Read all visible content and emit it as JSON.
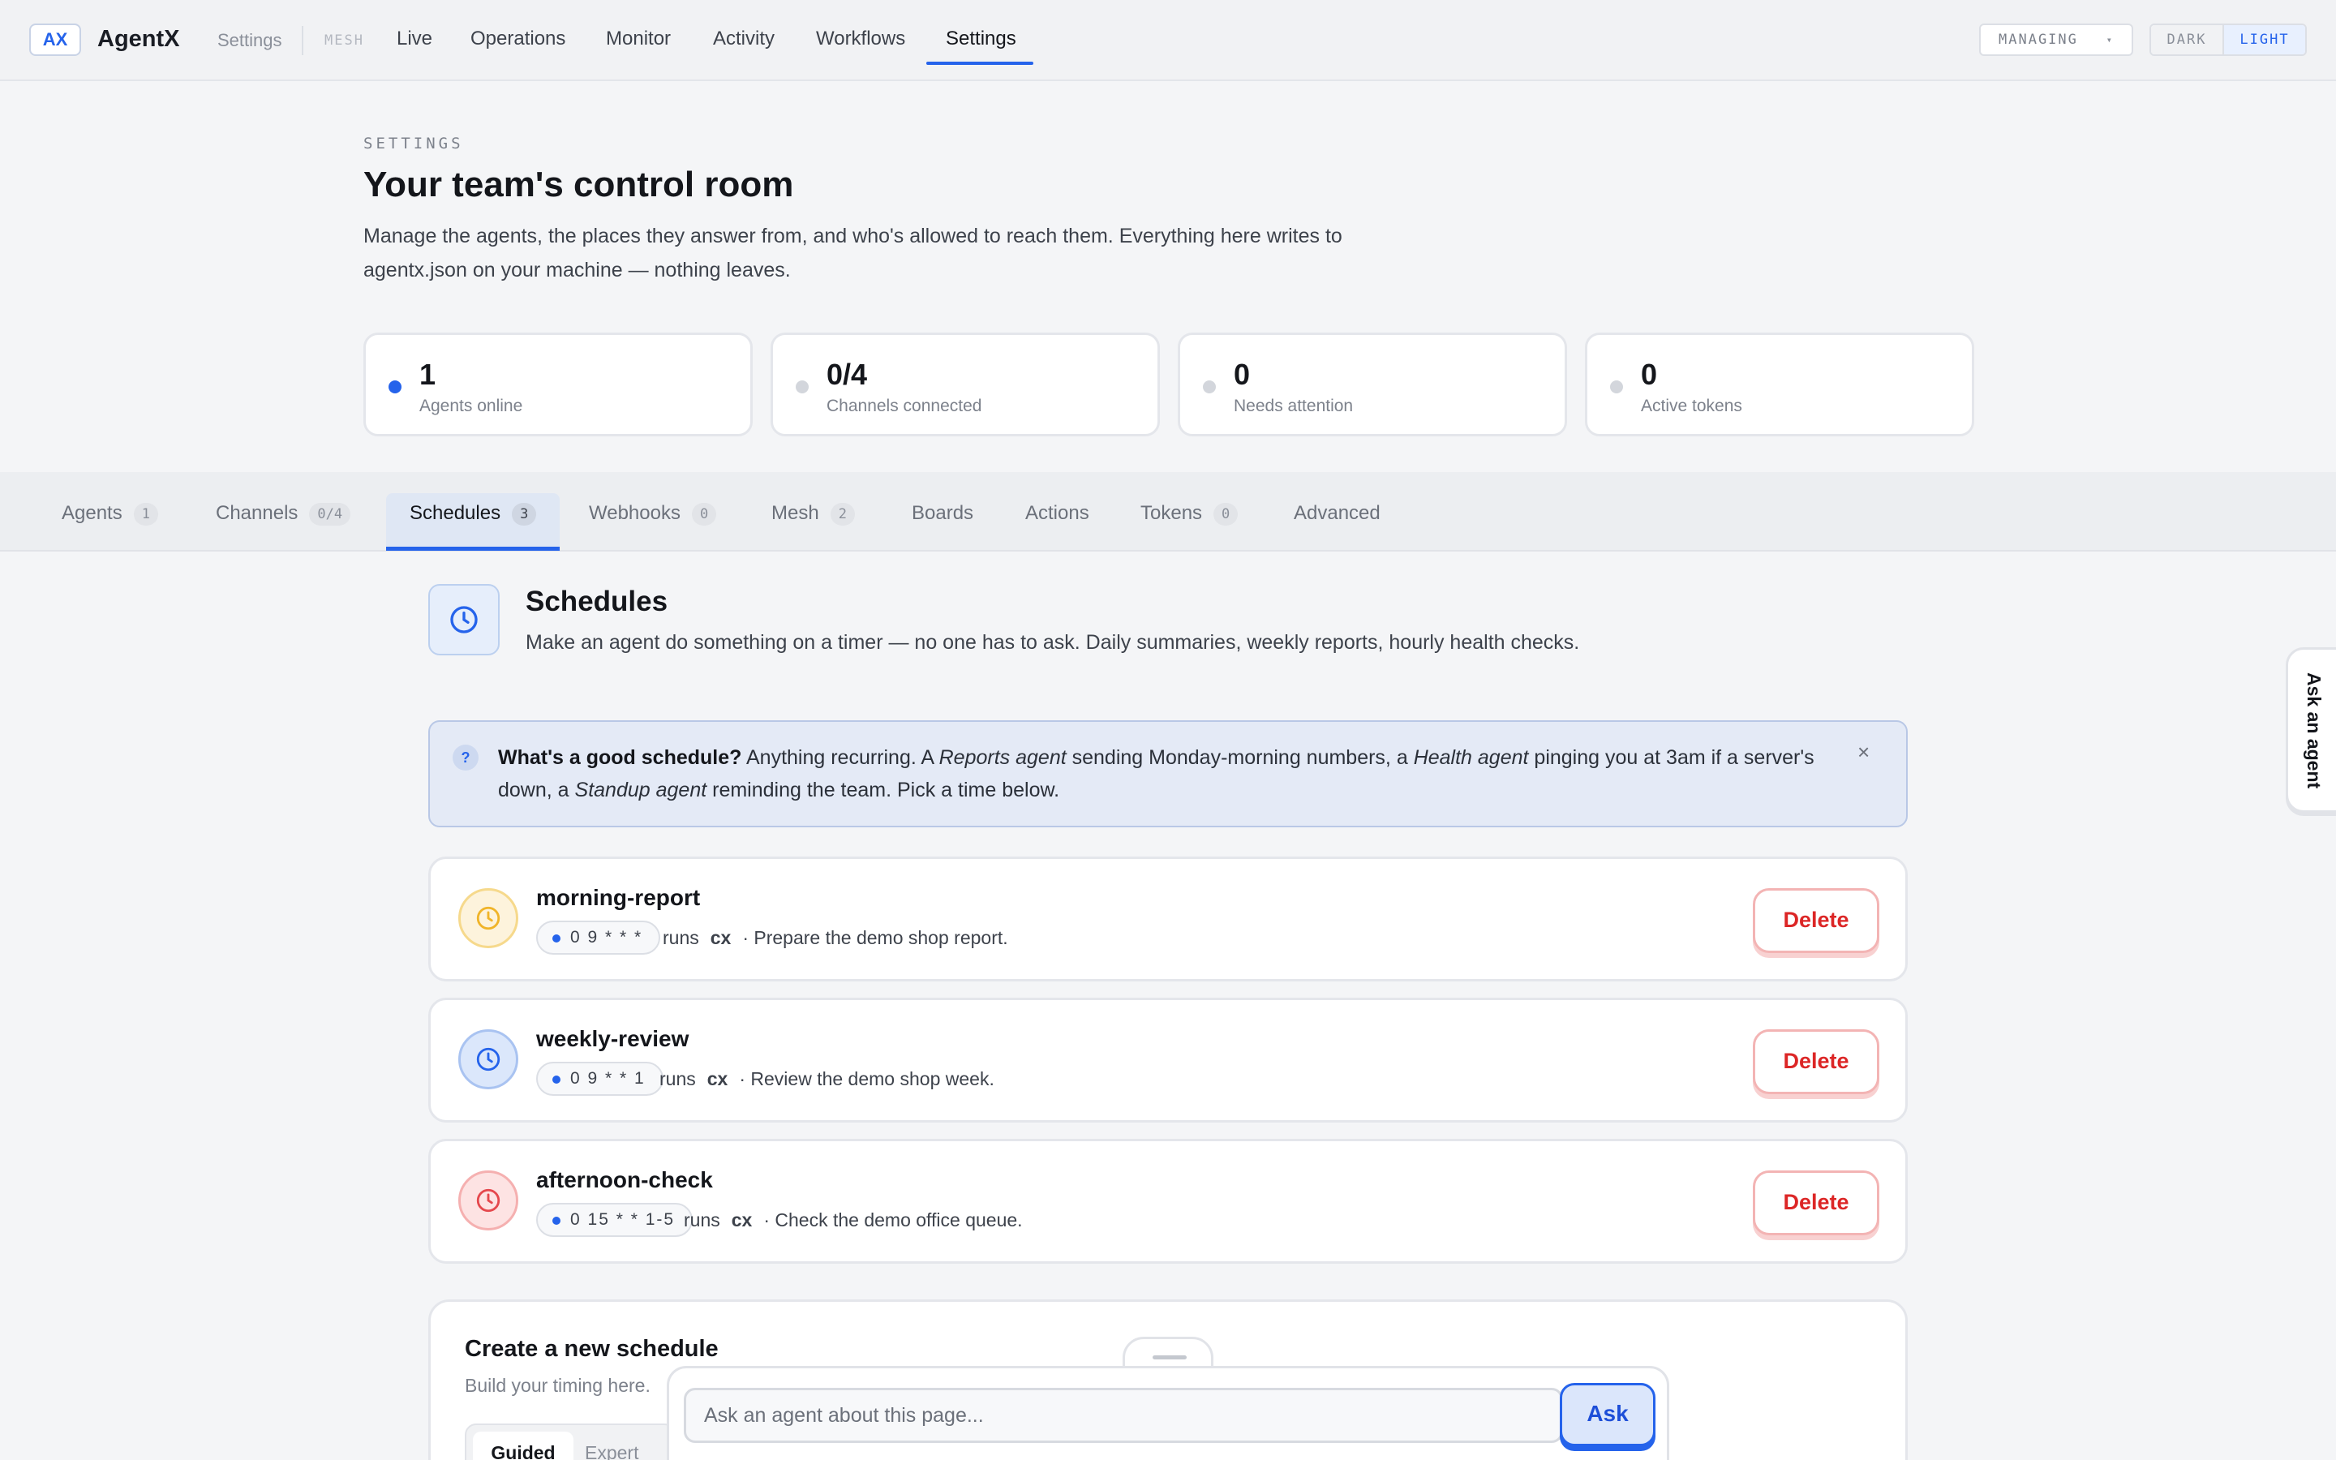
{
  "topbar": {
    "logo": "AX",
    "brand": "AgentX",
    "crumb": "Settings",
    "mesh_tag": "MESH",
    "nav": [
      "Live",
      "Operations",
      "Monitor",
      "Activity",
      "Workflows",
      "Settings"
    ],
    "active_nav": "Settings",
    "managing_label": "MANAGING",
    "theme": {
      "dark": "DARK",
      "light": "LIGHT",
      "selected": "LIGHT"
    }
  },
  "header": {
    "eyebrow": "SETTINGS",
    "title": "Your team's control room",
    "description": "Manage the agents, the places they answer from, and who's allowed to reach them. Everything here writes to agentx.json on your machine — nothing leaves."
  },
  "stats": [
    {
      "value": "1",
      "label": "Agents online",
      "dot": "active"
    },
    {
      "value": "0/4",
      "label": "Channels connected",
      "dot": "idle"
    },
    {
      "value": "0",
      "label": "Needs attention",
      "dot": "idle"
    },
    {
      "value": "0",
      "label": "Active tokens",
      "dot": "idle"
    }
  ],
  "tabs": [
    {
      "label": "Agents",
      "count": "1"
    },
    {
      "label": "Channels",
      "count": "0/4"
    },
    {
      "label": "Schedules",
      "count": "3"
    },
    {
      "label": "Webhooks",
      "count": "0"
    },
    {
      "label": "Mesh",
      "count": "2"
    },
    {
      "label": "Boards",
      "count": ""
    },
    {
      "label": "Actions",
      "count": ""
    },
    {
      "label": "Tokens",
      "count": "0"
    },
    {
      "label": "Advanced",
      "count": ""
    }
  ],
  "active_tab": "Schedules",
  "section": {
    "title": "Schedules",
    "description": "Make an agent do something on a timer — no one has to ask. Daily summaries, weekly reports, hourly health checks."
  },
  "tip": {
    "lead": "What's a good schedule?",
    "t1": " Anything recurring. A ",
    "e1": "Reports agent",
    "t2": " sending Monday-morning numbers, a ",
    "e2": "Health agent",
    "t3": " pinging you at 3am if a server's down, a ",
    "e3": "Standup agent",
    "t4": " reminding the team. Pick a time below.",
    "close": "×"
  },
  "schedules": [
    {
      "name": "morning-report",
      "cron": "0 9 * * *",
      "runs": "runs",
      "agent": "cx",
      "task": "· Prepare the demo shop report.",
      "color": "#f0b429"
    },
    {
      "name": "weekly-review",
      "cron": "0 9 * * 1",
      "runs": "runs",
      "agent": "cx",
      "task": "· Review the demo shop week.",
      "color": "#2563eb"
    },
    {
      "name": "afternoon-check",
      "cron": "0 15 * * 1-5",
      "runs": "runs",
      "agent": "cx",
      "task": "· Check the demo office queue.",
      "color": "#e5484d"
    }
  ],
  "delete_label": "Delete",
  "create": {
    "title": "Create a new schedule",
    "subtitle": "Build your timing here.",
    "modes": [
      "Guided",
      "Expert"
    ]
  },
  "ask": {
    "placeholder": "Ask an agent about this page...",
    "button": "Ask",
    "side_tab": "Ask an agent"
  }
}
